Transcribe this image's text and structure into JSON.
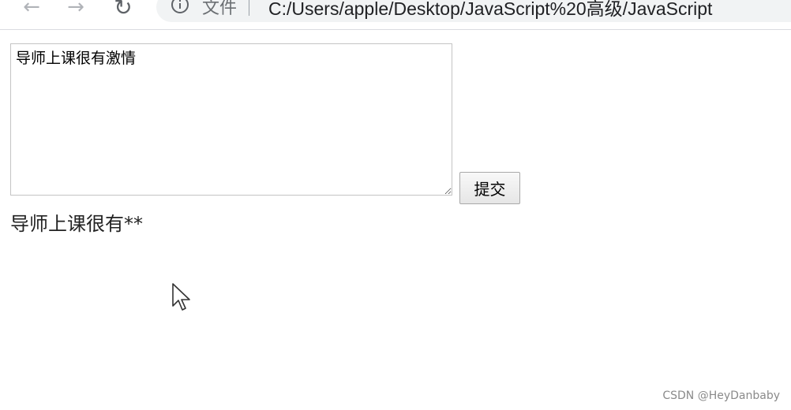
{
  "browser": {
    "back_glyph": "←",
    "forward_glyph": "→",
    "reload_glyph": "↻",
    "scheme_label": "文件",
    "url": "C:/Users/apple/Desktop/JavaScript%20高级/JavaScript"
  },
  "form": {
    "textarea_value": "导师上课很有激情",
    "submit_label": "提交"
  },
  "output": {
    "text": "导师上课很有**"
  },
  "watermark": {
    "text": "CSDN @HeyDanbaby"
  }
}
